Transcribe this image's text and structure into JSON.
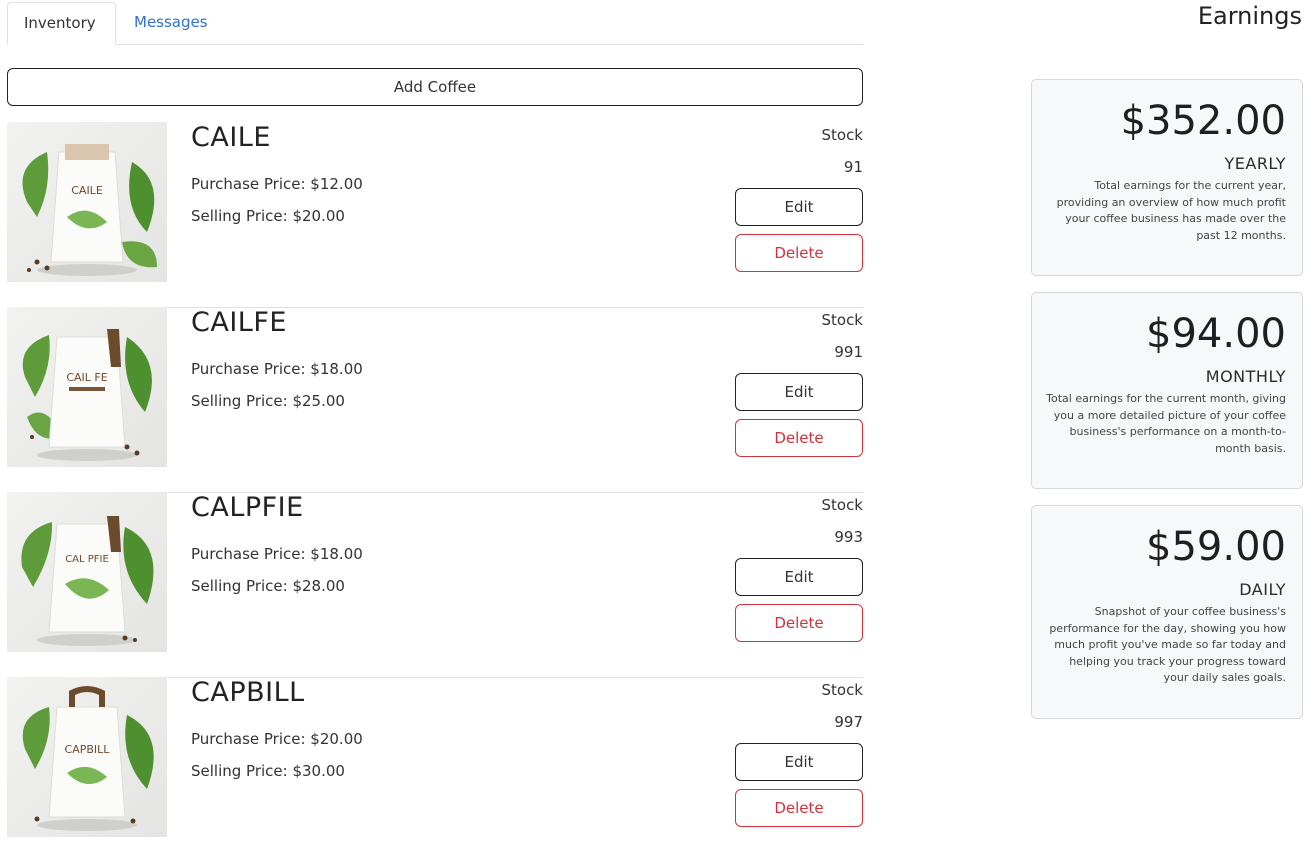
{
  "tabs": [
    {
      "label": "Inventory",
      "active": true
    },
    {
      "label": "Messages",
      "active": false
    }
  ],
  "add_button": "Add Coffee",
  "products": [
    {
      "name": "CAILE",
      "purchase": "Purchase Price: $12.00",
      "selling": "Selling Price: $20.00",
      "stock_label": "Stock",
      "stock": "91",
      "edit": "Edit",
      "delete": "Delete",
      "bag_text": "CAILE"
    },
    {
      "name": "CAILFE",
      "purchase": "Purchase Price: $18.00",
      "selling": "Selling Price: $25.00",
      "stock_label": "Stock",
      "stock": "991",
      "edit": "Edit",
      "delete": "Delete",
      "bag_text": "CAIL FE"
    },
    {
      "name": "CALPFIE",
      "purchase": "Purchase Price: $18.00",
      "selling": "Selling Price: $28.00",
      "stock_label": "Stock",
      "stock": "993",
      "edit": "Edit",
      "delete": "Delete",
      "bag_text": "CAL PFIE"
    },
    {
      "name": "CAPBILL",
      "purchase": "Purchase Price: $20.00",
      "selling": "Selling Price: $30.00",
      "stock_label": "Stock",
      "stock": "997",
      "edit": "Edit",
      "delete": "Delete",
      "bag_text": "CAPBILL"
    }
  ],
  "earnings": {
    "title": "Earnings",
    "cards": [
      {
        "amount": "$352.00",
        "period": "YEARLY",
        "description": "Total earnings for the current year, providing an overview of how much profit your coffee business has made over the past 12 months."
      },
      {
        "amount": "$94.00",
        "period": "MONTHLY",
        "description": "Total earnings for the current month, giving you a more detailed picture of your coffee business's performance on a month-to-month basis."
      },
      {
        "amount": "$59.00",
        "period": "DAILY",
        "description": "Snapshot of your coffee business's performance for the day, showing you how much profit you've made so far today and helping you track your progress toward your daily sales goals."
      }
    ]
  },
  "colors": {
    "accent_link": "#2f6fd6",
    "danger": "#d0323b",
    "card_bg": "#f7f8f9"
  }
}
